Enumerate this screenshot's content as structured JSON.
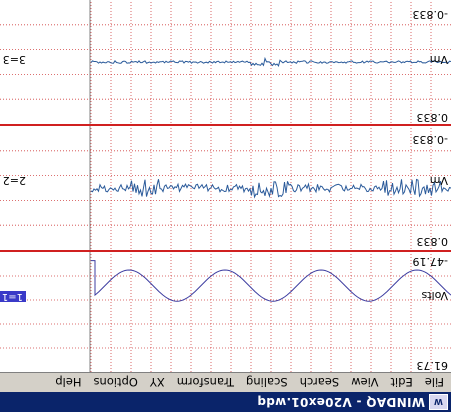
{
  "window": {
    "title": "WINDAQ - V20ex01.wdq",
    "icon": "windaq-app-icon",
    "accent": "#0a246a"
  },
  "menu": {
    "items": [
      "File",
      "Edit",
      "View",
      "Search",
      "Scaling",
      "Transform",
      "XY",
      "Options",
      "Help"
    ]
  },
  "channels": [
    {
      "id": "1=1",
      "unit": "Volts",
      "top_value": "61.73",
      "bottom_value": "-47.19",
      "waveform": "sine",
      "trace_color": "#3c3ca0",
      "selected": true
    },
    {
      "id": "2=2",
      "unit": "Vm",
      "top_value": "0.833",
      "bottom_value": "-0.833",
      "waveform": "noise",
      "trace_color": "#2a5a9a",
      "selected": false
    },
    {
      "id": "3=3",
      "unit": "Vm",
      "top_value": "0.833",
      "bottom_value": "-0.833",
      "waveform": "noise-low",
      "trace_color": "#2a5a9a",
      "selected": false
    }
  ],
  "colors": {
    "grid": "#d04040",
    "separator": "#d02020",
    "background": "#ffffff"
  }
}
